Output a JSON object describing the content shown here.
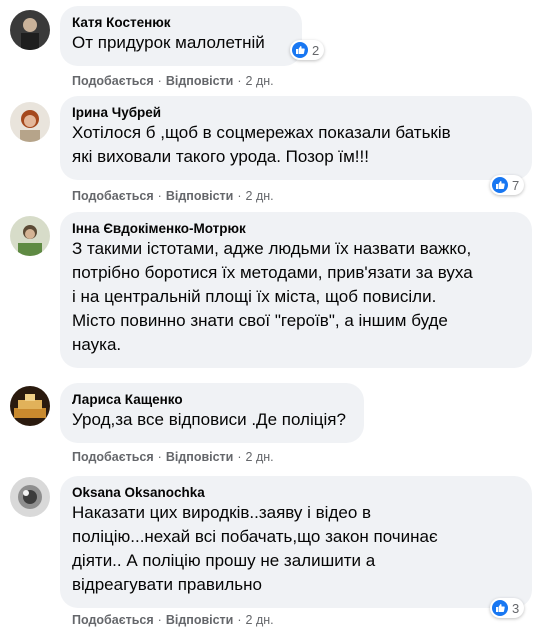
{
  "comments": [
    {
      "author": "Катя Костенюк",
      "text": "От придурок малолетній",
      "like_label": "Подобається",
      "reply_label": "Відповісти",
      "time": "2 дн.",
      "reactions": "2",
      "reaction_icon": "like-icon"
    },
    {
      "author": "Ірина Чубрей",
      "text": "Хотілося б ,щоб в соцмережах показали батьків\nякі виховали такого урода. Позор їм!!!",
      "like_label": "Подобається",
      "reply_label": "Відповісти",
      "time": "2 дн.",
      "reactions": "7",
      "reaction_icon": "like-icon"
    },
    {
      "author": "Інна Євдокіменко-Мотрюк",
      "text": "З такими істотами, адже людьми їх назвати важко,\nпотрібно боротися їх методами, прив'язати за вуха\nі на центральній площі їх міста, щоб повисіли.\nМісто повинно знати свої \"героїв\", а іншим буде\nнаука.",
      "like_label": "",
      "reply_label": "",
      "time": ""
    },
    {
      "author": "Лариса Кащенко",
      "text": "Урод,за все відповиси .Де поліція?",
      "like_label": "Подобається",
      "reply_label": "Відповісти",
      "time": "2 дн."
    },
    {
      "author": "Oksana Oksanochka",
      "text": "Наказати цих виродків..заяву і відео в\nполіцію...нехай всі побачать,що закон починає\nдіяти.. А поліцію прошу не залишити а\nвідреагувати правильно",
      "like_label": "Подобається",
      "reply_label": "Відповісти",
      "time": "2 дн.",
      "reactions": "3",
      "reaction_icon": "like-icon"
    }
  ],
  "colors": {
    "bubble": "#f0f2f5",
    "text": "#050505",
    "meta": "#65676b",
    "like_blue": "#1877f2"
  }
}
